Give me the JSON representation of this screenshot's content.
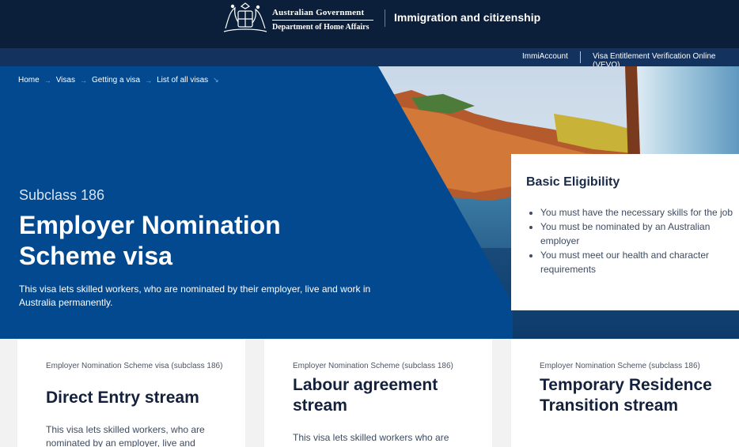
{
  "header": {
    "gov_line1": "Australian Government",
    "gov_line2": "Department of Home Affairs",
    "site_title": "Immigration and citizenship"
  },
  "subnav": {
    "links": [
      "ImmiAccount",
      "Visa Entitlement Verification Online (VEVO)"
    ]
  },
  "breadcrumb": {
    "items": [
      "Home",
      "Visas",
      "Getting a visa",
      "List of all visas"
    ]
  },
  "hero": {
    "subclass": "Subclass 186",
    "title": "Employer Nomination Scheme visa",
    "description": "This visa lets skilled workers, who are nominated by their employer, live and work in Australia permanently."
  },
  "eligibility": {
    "heading": "Basic Eligibility",
    "items": [
      "You must have the necessary skills for the job",
      "You must be nominated by an Australian employer",
      "You must meet our health and character requirements"
    ]
  },
  "cards": [
    {
      "kicker": "Employer Nomination Scheme visa (subclass 186)",
      "title": "Direct Entry stream",
      "description": "This visa lets skilled workers, who are nominated by an employer, live and"
    },
    {
      "kicker": "Employer Nomination Scheme (subclass 186)",
      "title": "Labour agreement stream",
      "description": "This visa lets skilled workers who are"
    },
    {
      "kicker": "Employer Nomination Scheme (subclass 186)",
      "title": "Temporary Residence Transition stream",
      "description": ""
    }
  ],
  "colors": {
    "header_bg": "#0b1f3a",
    "subnav_bg": "#13335e",
    "hero_blue": "#03498f",
    "link_arrow": "#6fa8ff"
  }
}
